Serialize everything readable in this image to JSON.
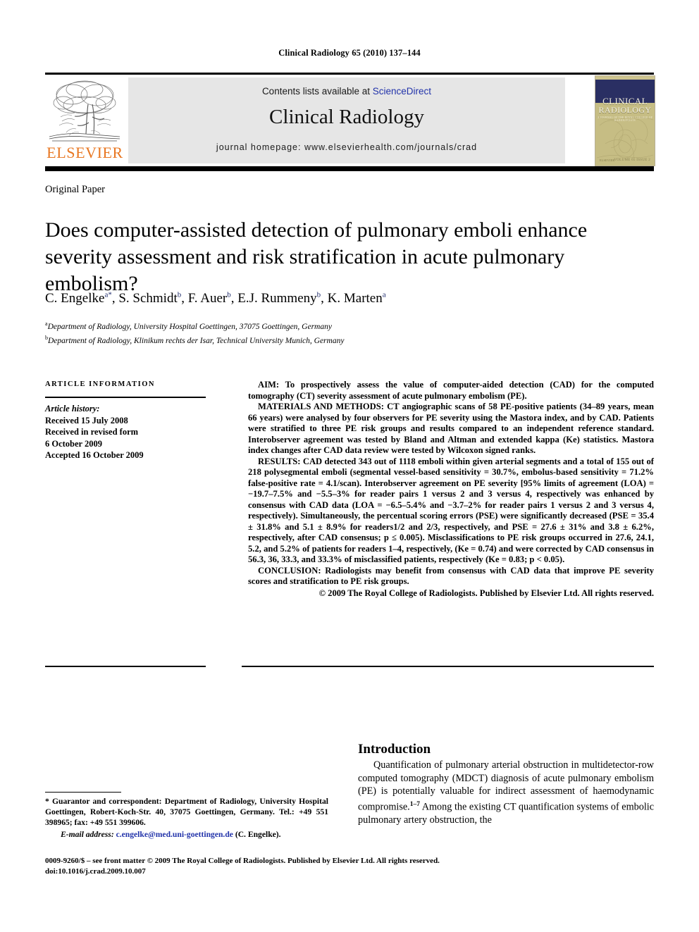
{
  "running_head": "Clinical Radiology 65 (2010) 137–144",
  "masthead": {
    "publisher_logo_text": "ELSEVIER",
    "contents_prefix": "Contents lists available at ",
    "contents_link": "ScienceDirect",
    "journal_title": "Clinical Radiology",
    "homepage_line": "journal homepage: www.elsevierhealth.com/journals/crad",
    "cover": {
      "title_line1": "CLINICAL",
      "title_line2": "RADIOLOGY",
      "subtitle": "A JOURNAL OF THE ROYAL COLLEGE OF RADIOLOGISTS",
      "foot_left": "ELSEVIER",
      "foot_right": "VOLUME 65 ISSUE 2"
    }
  },
  "article": {
    "section_label": "Original Paper",
    "title": "Does computer-assisted detection of pulmonary emboli enhance severity assessment and risk stratification in acute pulmonary embolism?",
    "authors": [
      {
        "name": "C. Engelke",
        "sup": "a",
        "star": true
      },
      {
        "name": "S. Schmidt",
        "sup": "b",
        "star": false
      },
      {
        "name": "F. Auer",
        "sup": "b",
        "star": false
      },
      {
        "name": "E.J. Rummeny",
        "sup": "b",
        "star": false
      },
      {
        "name": "K. Marten",
        "sup": "a",
        "star": false
      }
    ],
    "affiliations": [
      {
        "marker": "a",
        "text": "Department of Radiology, University Hospital Goettingen, 37075 Goettingen, Germany"
      },
      {
        "marker": "b",
        "text": "Department of Radiology, Klinikum rechts der Isar, Technical University Munich, Germany"
      }
    ]
  },
  "article_information": {
    "heading": "ARTICLE INFORMATION",
    "history_label": "Article history:",
    "history_lines": [
      "Received 15 July 2008",
      "Received in revised form",
      "6 October 2009",
      "Accepted 16 October 2009"
    ]
  },
  "abstract": {
    "aim": "AIM: To prospectively assess the value of computer-aided detection (CAD) for the computed tomography (CT) severity assessment of acute pulmonary embolism (PE).",
    "materials": "MATERIALS AND METHODS: CT angiographic scans of 58 PE-positive patients (34–89 years, mean 66 years) were analysed by four observers for PE severity using the Mastora index, and by CAD. Patients were stratified to three PE risk groups and results compared to an independent reference standard. Interobserver agreement was tested by Bland and Altman and extended kappa (Ke) statistics. Mastora index changes after CAD data review were tested by Wilcoxon signed ranks.",
    "results": "RESULTS: CAD detected 343 out of 1118 emboli within given arterial segments and a total of 155 out of 218 polysegmental emboli (segmental vessel-based sensitivity = 30.7%, embolus-based sensitivity = 71.2% false-positive rate = 4.1/scan). Interobserver agreement on PE severity [95% limits of agreement (LOA) = −19.7–7.5% and −5.5–3% for reader pairs 1 versus 2 and 3 versus 4, respectively was enhanced by consensus with CAD data (LOA = −6.5–5.4% and −3.7–2% for reader pairs 1 versus 2 and 3 versus 4, respectively). Simultaneously, the percentual scoring errors (PSE) were significantly decreased (PSE = 35.4 ± 31.8% and 5.1 ± 8.9% for readers1/2 and 2/3, respectively, and PSE = 27.6 ± 31% and 3.8 ± 6.2%, respectively, after CAD consensus; p ≤ 0.005). Misclassifications to PE risk groups occurred in 27.6, 24.1, 5.2, and 5.2% of patients for readers 1–4, respectively, (Ke = 0.74) and were corrected by CAD consensus in 56.3, 36, 33.3, and 33.3% of misclassified patients, respectively (Ke = 0.83; p < 0.05).",
    "conclusion": "CONCLUSION: Radiologists may benefit from consensus with CAD data that improve PE severity scores and stratification to PE risk groups.",
    "copyright": "© 2009 The Royal College of Radiologists. Published by Elsevier Ltd. All rights reserved."
  },
  "footnote": {
    "correspondence": "* Guarantor and correspondent: Department of Radiology, University Hospital Goettingen, Robert-Koch-Str. 40, 37075 Goettingen, Germany. Tel.: +49 551 398965; fax: +49 551 399606.",
    "email_label": "E-mail address:",
    "email": "c.engelke@med.uni-goettingen.de",
    "email_owner": "(C. Engelke)."
  },
  "imprint": {
    "line1": "0009-9260/$ – see front matter © 2009 The Royal College of Radiologists. Published by Elsevier Ltd. All rights reserved.",
    "line2": "doi:10.1016/j.crad.2009.10.007"
  },
  "introduction": {
    "heading": "Introduction",
    "paragraph_part1": "Quantification of pulmonary arterial obstruction in multidetector-row computed tomography (MDCT) diagnosis of acute pulmonary embolism (PE) is potentially valuable for indirect assessment of haemodynamic compromise.",
    "citation": "1–7",
    "paragraph_part2": " Among the existing CT quantification systems of embolic pulmonary artery obstruction, the"
  },
  "colors": {
    "link": "#2233aa",
    "elsevier_orange": "#E87722",
    "cover_navy": "#2a2f63",
    "cover_olive": "#c6bd84",
    "banner_grey": "#e6e6e6"
  }
}
